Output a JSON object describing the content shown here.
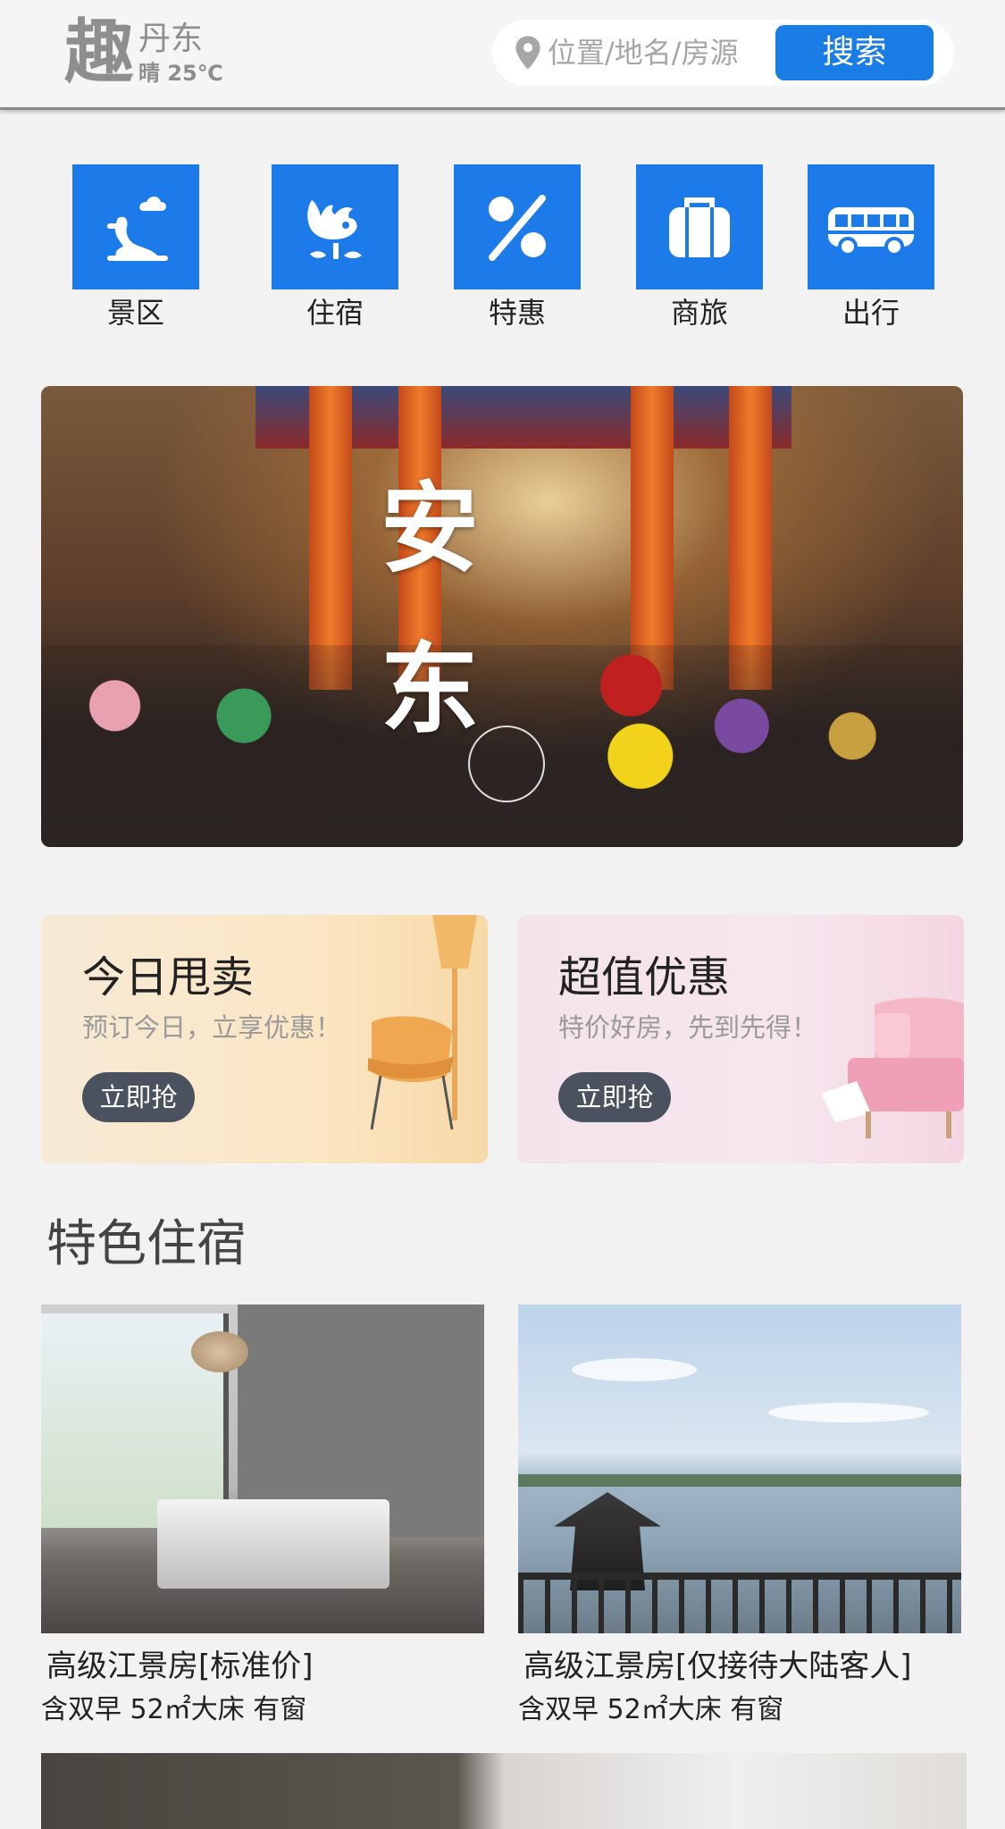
{
  "header": {
    "logo": "趣",
    "city": "丹东",
    "weather": "晴 25℃",
    "search": {
      "placeholder": "位置/地名/房源",
      "button_label": "搜索"
    }
  },
  "categories": [
    {
      "label": "景区",
      "icon": "scenic-icon"
    },
    {
      "label": "住宿",
      "icon": "lodging-icon"
    },
    {
      "label": "特惠",
      "icon": "discount-icon"
    },
    {
      "label": "商旅",
      "icon": "luggage-icon"
    },
    {
      "label": "出行",
      "icon": "bus-icon"
    }
  ],
  "banner": {
    "calligraphy": "安东"
  },
  "promos": [
    {
      "title": "今日甩卖",
      "subtitle": "预订今日，立享优惠！",
      "button": "立即抢"
    },
    {
      "title": "超值优惠",
      "subtitle": "特价好房，先到先得！",
      "button": "立即抢"
    }
  ],
  "section": {
    "title": "特色住宿"
  },
  "listings": [
    {
      "title": "高级江景房[标准价]",
      "desc": "含双早 52㎡大床 有窗"
    },
    {
      "title": "高级江景房[仅接待大陆客人]",
      "desc": "含双早 52㎡大床 有窗"
    }
  ],
  "colors": {
    "accent": "#1a7de6",
    "promo_button": "#4a5260",
    "background": "#f2f2f2"
  }
}
